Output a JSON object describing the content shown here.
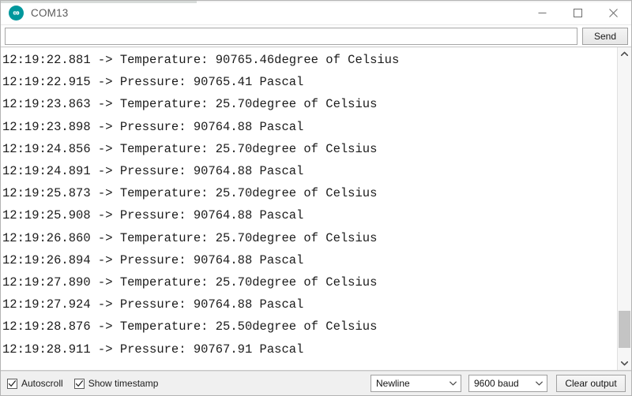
{
  "window": {
    "title": "COM13",
    "app_icon": "arduino-logo-icon",
    "controls": {
      "minimize": "minimize-icon",
      "maximize": "maximize-icon",
      "close": "close-icon"
    }
  },
  "send_row": {
    "input_value": "",
    "input_placeholder": "",
    "send_label": "Send"
  },
  "console": {
    "lines": [
      "12:19:22.881 -> Temperature: 90765.46degree of Celsius",
      "12:19:22.915 -> Pressure: 90765.41 Pascal",
      "12:19:23.863 -> Temperature: 25.70degree of Celsius",
      "12:19:23.898 -> Pressure: 90764.88 Pascal",
      "12:19:24.856 -> Temperature: 25.70degree of Celsius",
      "12:19:24.891 -> Pressure: 90764.88 Pascal",
      "12:19:25.873 -> Temperature: 25.70degree of Celsius",
      "12:19:25.908 -> Pressure: 90764.88 Pascal",
      "12:19:26.860 -> Temperature: 25.70degree of Celsius",
      "12:19:26.894 -> Pressure: 90764.88 Pascal",
      "12:19:27.890 -> Temperature: 25.70degree of Celsius",
      "12:19:27.924 -> Pressure: 90764.88 Pascal",
      "12:19:28.876 -> Temperature: 25.50degree of Celsius",
      "12:19:28.911 -> Pressure: 90767.91 Pascal"
    ]
  },
  "scrollbar": {
    "up_arrow": "chevron-up-icon",
    "down_arrow": "chevron-down-icon"
  },
  "status_bar": {
    "autoscroll": {
      "label": "Autoscroll",
      "checked": true
    },
    "show_timestamp": {
      "label": "Show timestamp",
      "checked": true
    },
    "line_ending": {
      "value": "Newline"
    },
    "baud_rate": {
      "value": "9600 baud"
    },
    "clear_label": "Clear output"
  },
  "colors": {
    "accent": "#00979c",
    "window_bg": "#ffffff",
    "status_bg": "#f0f0f0",
    "text": "#1b1b1b"
  }
}
